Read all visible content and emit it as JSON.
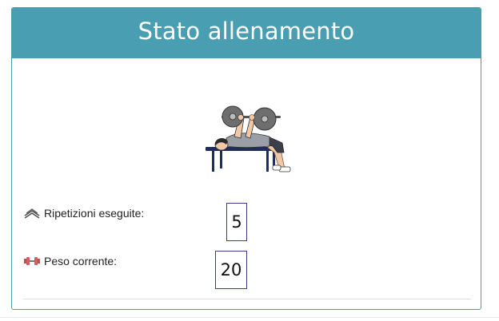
{
  "panel": {
    "title": "Stato allenamento"
  },
  "illustration": {
    "icon": "bench-press-illustration"
  },
  "stats": {
    "repetitions": {
      "icon": "chevrons-up-icon",
      "label": "Ripetizioni eseguite:",
      "value": "5"
    },
    "weight": {
      "icon": "dumbbell-icon",
      "label": "Peso corrente:",
      "value": "20"
    }
  },
  "colors": {
    "header_background": "#4a9eb2",
    "value_border": "#3c3c8c"
  }
}
